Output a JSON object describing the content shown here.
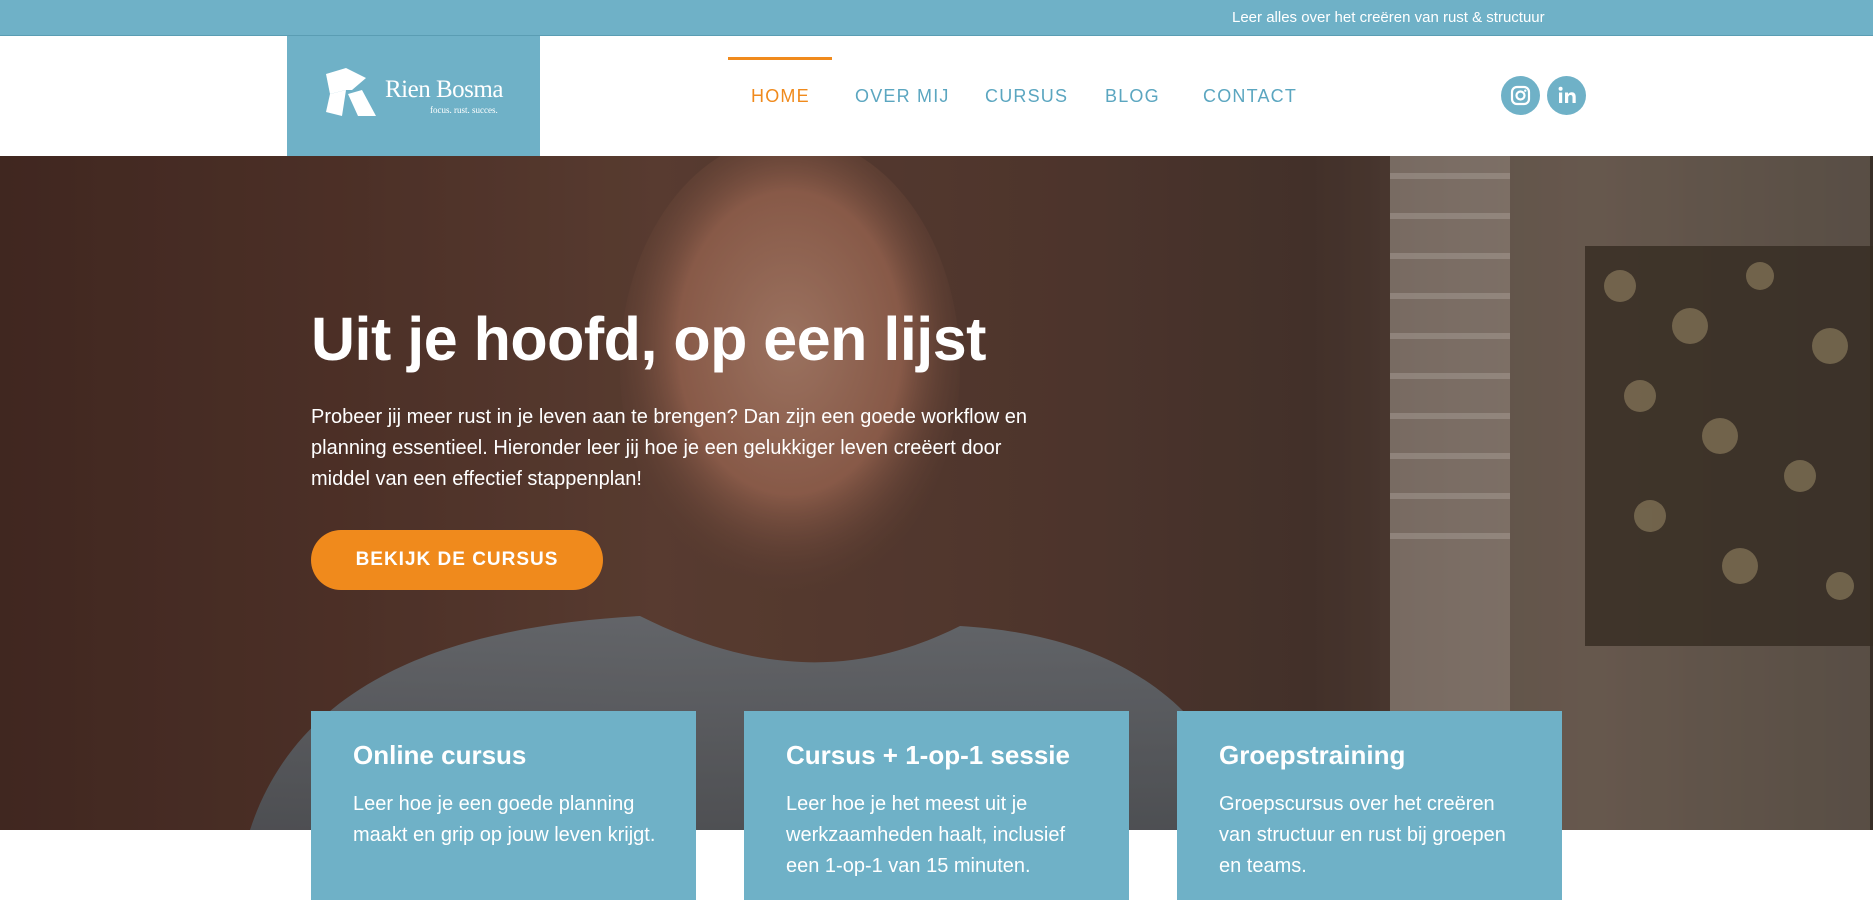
{
  "colors": {
    "primary": "#6fb1c7",
    "accent": "#f08a1c",
    "nav_text": "#5ba6c0",
    "white": "#ffffff"
  },
  "topbar": {
    "text": "Leer alles over het creëren van rust & structuur"
  },
  "logo": {
    "name": "Rien Bosma",
    "tagline": "focus. rust. succes."
  },
  "nav": {
    "items": [
      {
        "label": "HOME",
        "active": true
      },
      {
        "label": "OVER MIJ",
        "active": false
      },
      {
        "label": "CURSUS",
        "active": false
      },
      {
        "label": "BLOG",
        "active": false
      },
      {
        "label": "CONTACT",
        "active": false
      }
    ]
  },
  "social": {
    "icons": [
      "instagram-icon",
      "linkedin-icon"
    ]
  },
  "hero": {
    "title": "Uit je hoofd, op een lijst",
    "text": "Probeer jij meer rust in je leven aan te brengen? Dan zijn een goede workflow en planning essentieel. Hieronder leer jij hoe je een gelukkiger leven creëert door middel van een effectief stappenplan!",
    "cta_label": "BEKIJK DE CURSUS"
  },
  "cards": [
    {
      "title": "Online cursus",
      "text": "Leer hoe je een goede planning maakt en grip op jouw leven krijgt."
    },
    {
      "title": "Cursus + 1-op-1 sessie",
      "text": "Leer hoe je het meest uit je werkzaamheden haalt, inclusief een 1-op-1 van 15 minuten."
    },
    {
      "title": "Groepstraining",
      "text": "Groepscursus over het creëren van structuur en rust bij groepen en teams."
    }
  ]
}
